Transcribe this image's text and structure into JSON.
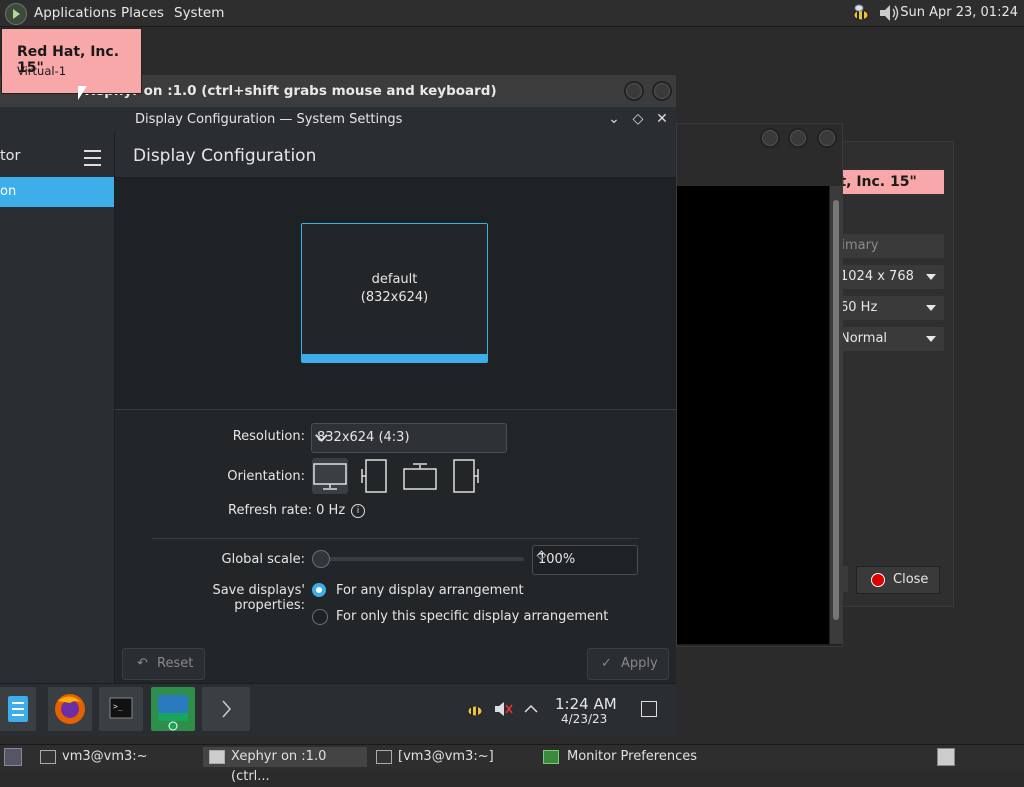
{
  "top_panel": {
    "menus": [
      "Applications",
      "Places",
      "System"
    ],
    "clock": "Sun Apr 23, 01:24"
  },
  "tooltip": {
    "title": "Red Hat, Inc. 15\"",
    "subtitle": "Virtual-1"
  },
  "xephyr": {
    "title": "Xephyr on :1.0 (ctrl+shift grabs mouse and keyboard)"
  },
  "kde_window": {
    "title": "Display Configuration — System Settings",
    "sidebar_heading": "tor",
    "sidebar_active": "on",
    "page_title": "Display Configuration",
    "screen": {
      "name": "default",
      "size": "(832x624)"
    },
    "resolution_label": "Resolution:",
    "resolution_value": "832x624 (4:3)",
    "orientation_label": "Orientation:",
    "refresh_label": "Refresh rate: 0 Hz",
    "scale_label": "Global scale:",
    "scale_value": "100%",
    "save_label": "Save displays' properties:",
    "radio_any": "For any display arrangement",
    "radio_specific": "For only this specific display arrangement",
    "reset_label": "Reset",
    "apply_label": "Apply"
  },
  "kde_panel": {
    "time": "1:24 AM",
    "date": "4/23/23"
  },
  "monitor_prefs": {
    "monitor_label": "at, Inc. 15\"",
    "primary_label": "rimary",
    "resolution": "1024 x 768",
    "refresh": "60 Hz",
    "rotation": "Normal",
    "close_label": "Close"
  },
  "taskbar": {
    "items": [
      "vm3@vm3:~",
      "Xephyr on :1.0 (ctrl...",
      "[vm3@vm3:~]",
      "Monitor Preferences"
    ]
  },
  "colors": {
    "accent": "#3daee9",
    "tooltip_bg": "#f8a8a8"
  }
}
